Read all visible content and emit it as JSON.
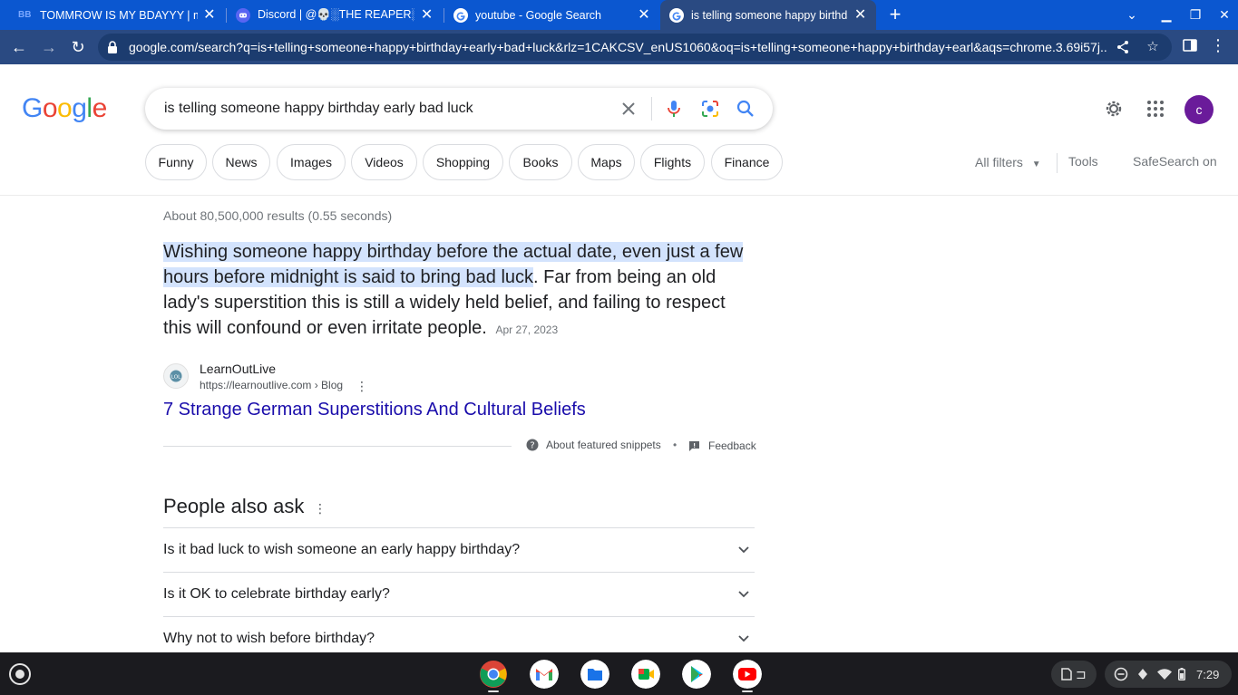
{
  "tabs": [
    {
      "title": "TOMMROW IS MY BDAYYY | mpp",
      "favicon": "bb-icon"
    },
    {
      "title": "Discord | @💀░THE REAPER░ (",
      "favicon": "discord-icon"
    },
    {
      "title": "youtube - Google Search",
      "favicon": "google-icon"
    },
    {
      "title": "is telling someone happy birthday",
      "favicon": "google-icon"
    }
  ],
  "url": "google.com/search?q=is+telling+someone+happy+birthday+early+bad+luck&rlz=1CAKCSV_enUS1060&oq=is+telling+someone+happy+birthday+earl&aqs=chrome.3.69i57j...",
  "logo": {
    "letters": [
      "G",
      "o",
      "o",
      "g",
      "l",
      "e"
    ],
    "colors": [
      "#4285F4",
      "#EA4335",
      "#FBBC05",
      "#4285F4",
      "#34A853",
      "#EA4335"
    ]
  },
  "search": {
    "query": "is telling someone happy birthday early bad luck"
  },
  "avatar_letter": "c",
  "chips": [
    "Funny",
    "News",
    "Images",
    "Videos",
    "Shopping",
    "Books",
    "Maps",
    "Flights",
    "Finance"
  ],
  "toolbar": {
    "all_filters": "All filters",
    "tools": "Tools",
    "safesearch": "SafeSearch on"
  },
  "results": {
    "stats": "About 80,500,000 results (0.55 seconds)",
    "featured": {
      "highlight": "Wishing someone happy birthday before the actual date, even just a few hours before midnight is said to bring bad luck",
      "rest": ". Far from being an old lady's superstition this is still a widely held belief, and failing to respect this will confound or even irritate people.",
      "date": "Apr 27, 2023",
      "site_name": "LearnOutLive",
      "site_url": "https://learnoutlive.com › Blog",
      "title": "7 Strange German Superstitions And Cultural Beliefs",
      "about": "About featured snippets",
      "dot": "•",
      "feedback": "Feedback"
    }
  },
  "paa": {
    "title": "People also ask",
    "questions": [
      "Is it bad luck to wish someone an early happy birthday?",
      "Is it OK to celebrate birthday early?",
      "Why not to wish before birthday?"
    ]
  },
  "tray": {
    "time": "7:29"
  },
  "colors": {
    "link": "#1a0dab",
    "highlight": "#d3e3fd",
    "chrome_blue": "#2a4a82"
  }
}
